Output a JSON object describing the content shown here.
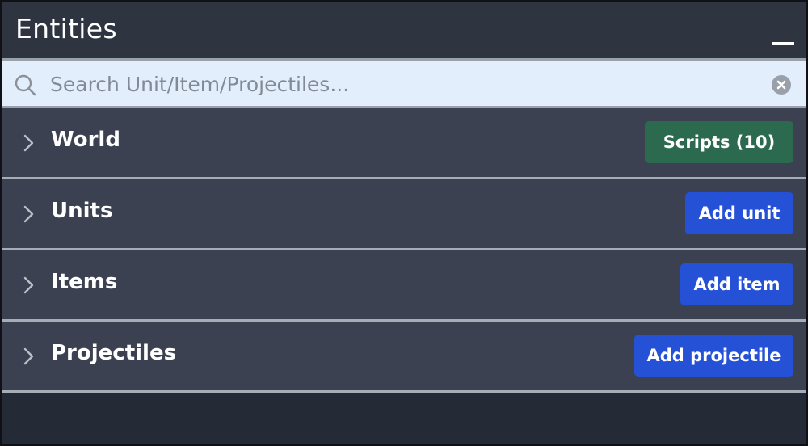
{
  "panel": {
    "title": "Entities"
  },
  "search": {
    "placeholder": "Search Unit/Item/Projectiles...",
    "value": ""
  },
  "sections": [
    {
      "label": "World",
      "button_label": "Scripts (10)",
      "button_color": "#2c6a4f"
    },
    {
      "label": "Units",
      "button_label": "Add unit",
      "button_color": "#2451d6"
    },
    {
      "label": "Items",
      "button_label": "Add item",
      "button_color": "#2451d6"
    },
    {
      "label": "Projectiles",
      "button_label": "Add projectile",
      "button_color": "#2451d6"
    }
  ],
  "icons": {
    "search": "search-icon",
    "clear": "clear-icon",
    "minimize": "minimize-icon",
    "expand": "chevron-right-icon"
  },
  "colors": {
    "header_bg": "#2e3440",
    "section_bg": "#3b4150",
    "search_bg": "#e2eefb",
    "green_button": "#2c6a4f",
    "blue_button": "#2451d6"
  }
}
